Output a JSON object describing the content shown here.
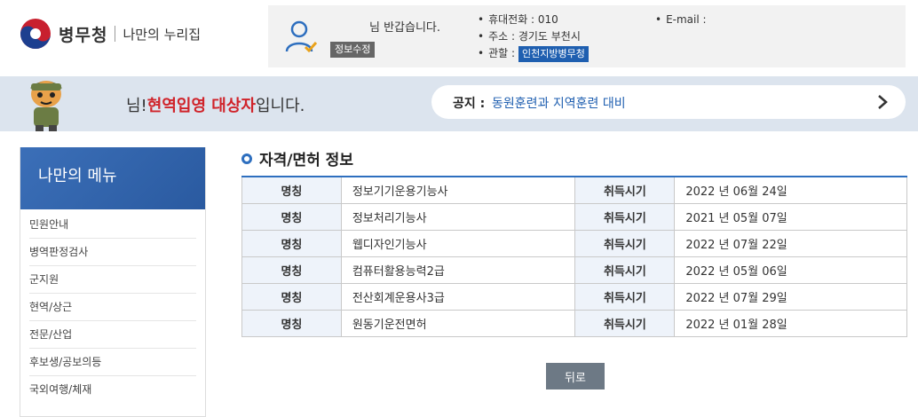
{
  "header": {
    "logo_name": "병무청",
    "logo_sub": "나만의 누리집",
    "greeting": "님 반갑습니다.",
    "edit_label": "정보수정",
    "phone": "휴대전화 : 010",
    "address": "주소 : 경기도 부천시",
    "jurisdiction_label": "관할 :",
    "jurisdiction_value": "인천지방병무청",
    "email": "E-mail :"
  },
  "banner": {
    "status_prefix": "님!",
    "status_highlight": "현역입영 대상자",
    "status_suffix": "입니다.",
    "notice_label": "공지 :",
    "notice_text": "동원훈련과 지역훈련 대비"
  },
  "sidebar": {
    "title": "나만의 메뉴",
    "items": [
      {
        "label": "민원안내"
      },
      {
        "label": "병역판정검사"
      },
      {
        "label": "군지원"
      },
      {
        "label": "현역/상근"
      },
      {
        "label": "전문/산업"
      },
      {
        "label": "후보생/공보의등"
      },
      {
        "label": "국외여행/체재"
      }
    ]
  },
  "main": {
    "title": "자격/면허 정보",
    "col_name": "명칭",
    "col_date": "취득시기",
    "rows": [
      {
        "name": "정보기기운용기능사",
        "date": "2022 년 06월 24일"
      },
      {
        "name": "정보처리기능사",
        "date": "2021 년 05월 07일"
      },
      {
        "name": "웹디자인기능사",
        "date": "2022 년 07월 22일"
      },
      {
        "name": "컴퓨터활용능력2급",
        "date": "2022 년 05월 06일"
      },
      {
        "name": "전산회계운용사3급",
        "date": "2022 년 07월 29일"
      },
      {
        "name": "원동기운전면허",
        "date": "2022 년 01월 28일"
      }
    ],
    "back_label": "뒤로"
  },
  "colors": {
    "accent": "#2e6fbf",
    "highlight": "#d0232a",
    "banner_bg": "#dce4ee"
  }
}
